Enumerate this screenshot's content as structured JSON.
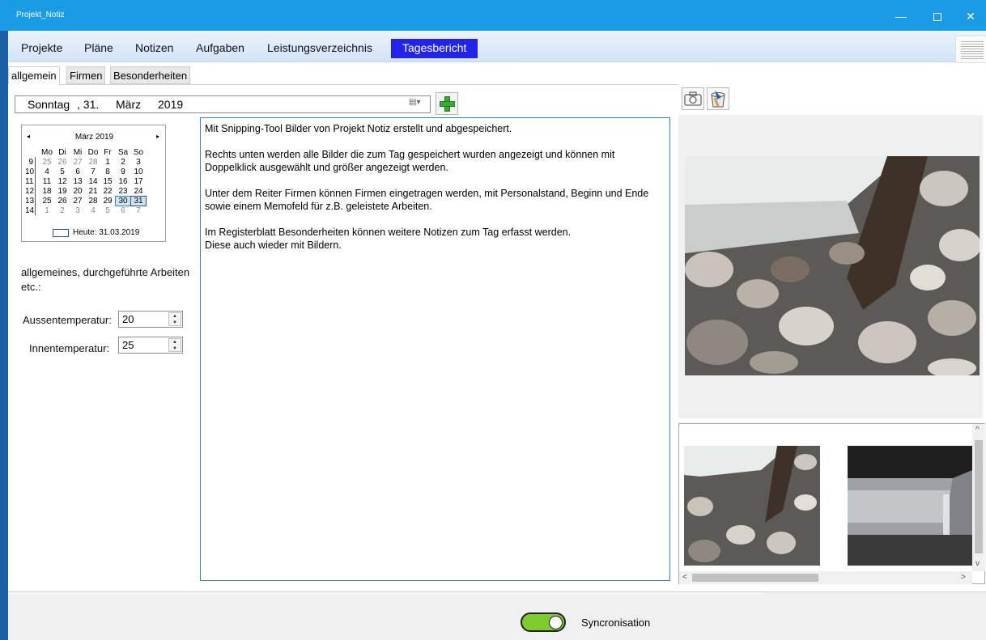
{
  "window": {
    "title": "Projekt_Notiz",
    "minimize": "—",
    "close": "✕"
  },
  "menu": [
    "Projekte",
    "Pläne",
    "Notizen",
    "Aufgaben",
    "Leistungsverzeichnis",
    "Tagesbericht"
  ],
  "menu_active": "Tagesbericht",
  "subtabs": [
    "allgemein",
    "Firmen",
    "Besonderheiten"
  ],
  "subtab_active": "allgemein",
  "date": {
    "weekday": "Sonntag",
    "day": ", 31.",
    "month": "März",
    "year": "2019"
  },
  "calendar": {
    "title": "März 2019",
    "prev": "◂",
    "next": "▸",
    "weekdays": [
      "Mo",
      "Di",
      "Mi",
      "Do",
      "Fr",
      "Sa",
      "So"
    ],
    "weeks": [
      {
        "kw": "9",
        "days": [
          "25",
          "26",
          "27",
          "28",
          "1",
          "2",
          "3"
        ]
      },
      {
        "kw": "10",
        "days": [
          "4",
          "5",
          "6",
          "7",
          "8",
          "9",
          "10"
        ]
      },
      {
        "kw": "11",
        "days": [
          "11",
          "12",
          "13",
          "14",
          "15",
          "16",
          "17"
        ]
      },
      {
        "kw": "12",
        "days": [
          "18",
          "19",
          "20",
          "21",
          "22",
          "23",
          "24"
        ]
      },
      {
        "kw": "13",
        "days": [
          "25",
          "26",
          "27",
          "28",
          "29",
          "30",
          "31"
        ]
      },
      {
        "kw": "14",
        "days": [
          "1",
          "2",
          "3",
          "4",
          "5",
          "6",
          "7"
        ]
      }
    ],
    "today_label": "Heute: 31.03.2019"
  },
  "left": {
    "notes_label": "allgemeines, durchgeführte Arbeiten etc.:",
    "outdoor_label": "Aussentemperatur:",
    "outdoor_value": "20",
    "indoor_label": "Innentemperatur:",
    "indoor_value": "25",
    "spin_up": "▲",
    "spin_down": "▼"
  },
  "memo": {
    "p1": "Mit Snipping-Tool Bilder von Projekt Notiz erstellt und abgespeichert.",
    "p2": "Rechts unten werden alle Bilder die zum Tag gespeichert wurden angezeigt und können mit Doppelklick ausgewählt und größer angezeigt werden.",
    "p3": "Unter dem Reiter Firmen können Firmen eingetragen werden, mit Personalstand, Beginn und Ende sowie einem Memofeld für z.B. geleistete Arbeiten.",
    "p4a": "Im Registerblatt Besonderheiten können weitere Notizen zum Tag erfasst werden.",
    "p4b": "Diese auch wieder mit Bildern."
  },
  "scroll": {
    "up": "^",
    "down": "v",
    "left": "<",
    "right": ">"
  },
  "footer": {
    "sync_label": "Syncronisation",
    "sync_on": true
  },
  "colors": {
    "titlebar": "#1a9be6",
    "active_tab": "#2222e8",
    "toggle_on": "#7ecb2c"
  },
  "icons": [
    "camera-icon",
    "bucket-icon",
    "plus-icon",
    "hamburger-icon"
  ]
}
